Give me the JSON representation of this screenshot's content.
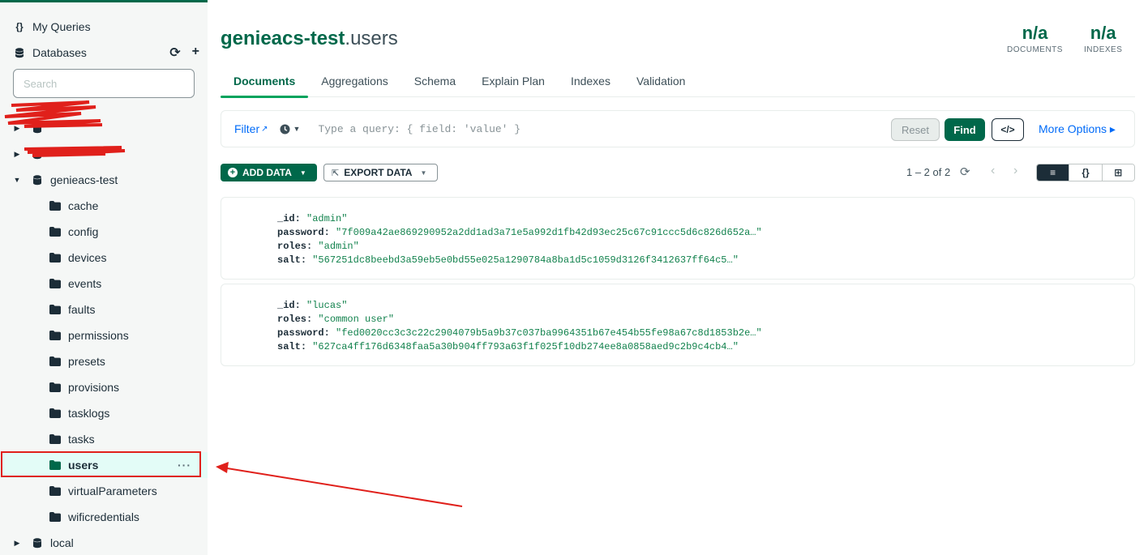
{
  "sidebar": {
    "my_queries": "My Queries",
    "databases": "Databases",
    "search_placeholder": "Search",
    "databases_list": [
      {
        "name": "genieacs-test"
      },
      {
        "name": "local"
      }
    ],
    "collections": [
      "cache",
      "config",
      "devices",
      "events",
      "faults",
      "permissions",
      "presets",
      "provisions",
      "tasklogs",
      "tasks",
      "users",
      "virtualParameters",
      "wificredentials"
    ],
    "selected_collection": "users",
    "more_dots": "···"
  },
  "header": {
    "db": "genieacs-test",
    "coll": ".users",
    "documents_value": "n/a",
    "documents_label": "DOCUMENTS",
    "indexes_value": "n/a",
    "indexes_label": "INDEXES"
  },
  "tabs": [
    "Documents",
    "Aggregations",
    "Schema",
    "Explain Plan",
    "Indexes",
    "Validation"
  ],
  "query": {
    "filter_label": "Filter",
    "placeholder": "Type a query: { field: 'value' }",
    "reset": "Reset",
    "find": "Find",
    "code": "</>",
    "more_options": "More Options ▸"
  },
  "toolbar": {
    "add_data": "ADD DATA",
    "export_data": "EXPORT DATA",
    "pager": "1 – 2 of 2",
    "view_list": "≡",
    "view_json": "{}",
    "view_table": "⊞"
  },
  "documents": [
    {
      "fields": [
        {
          "key": "_id",
          "value": "\"admin\""
        },
        {
          "key": "password",
          "value": "\"7f009a42ae869290952a2dd1ad3a71e5a992d1fb42d93ec25c67c91ccc5d6c826d652a…\""
        },
        {
          "key": "roles",
          "value": "\"admin\""
        },
        {
          "key": "salt",
          "value": "\"567251dc8beebd3a59eb5e0bd55e025a1290784a8ba1d5c1059d3126f3412637ff64c5…\""
        }
      ]
    },
    {
      "fields": [
        {
          "key": "_id",
          "value": "\"lucas\""
        },
        {
          "key": "roles",
          "value": "\"common user\""
        },
        {
          "key": "password",
          "value": "\"fed0020cc3c3c22c2904079b5a9b37c037ba9964351b67e454b55fe98a67c8d1853b2e…\""
        },
        {
          "key": "salt",
          "value": "\"627ca4ff176d6348faa5a30b904ff793a63f1f025f10db274ee8a0858aed9c2b9c4cb4…\""
        }
      ]
    }
  ],
  "colors": {
    "brand_green": "#00684a",
    "link_blue": "#016bf8",
    "annotation_red": "#e0201b"
  }
}
